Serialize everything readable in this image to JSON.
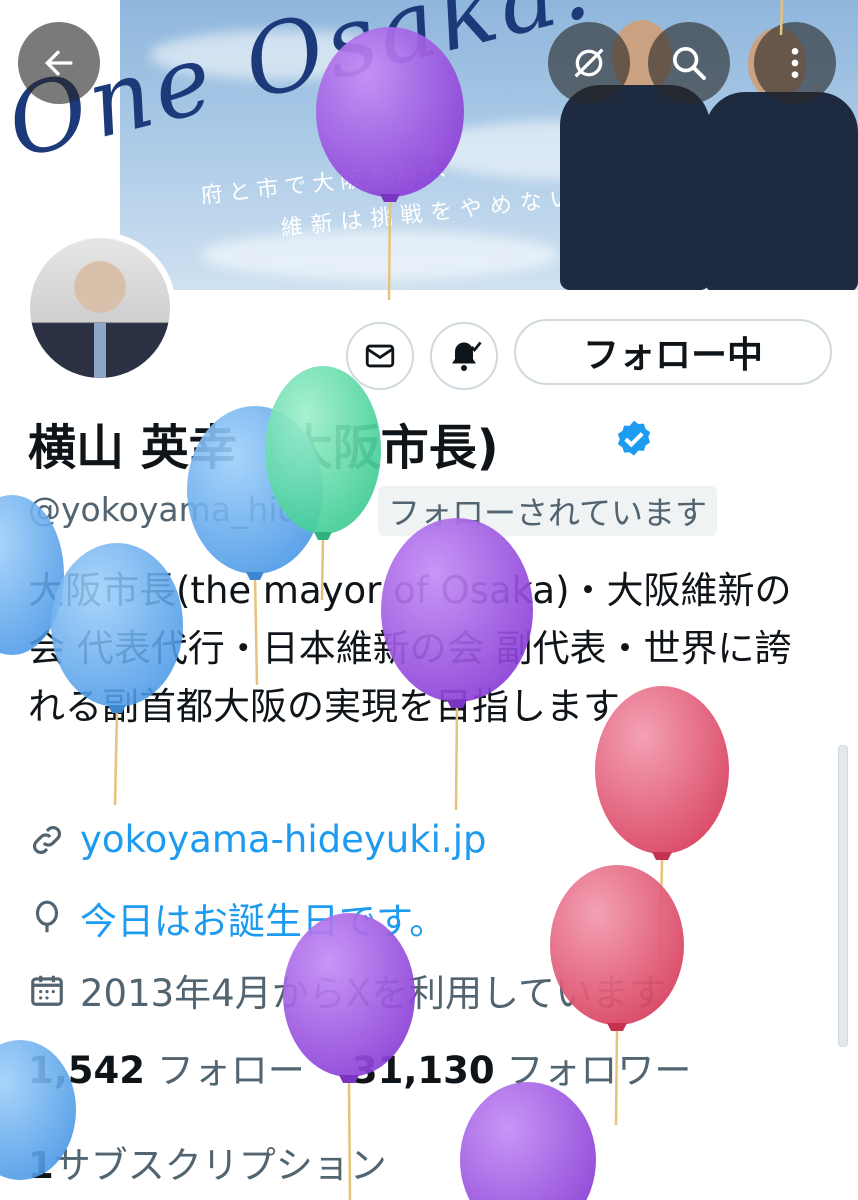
{
  "banner": {
    "slogan": "One Osaka!",
    "line1": "府と市で大阪を前へ",
    "line2": "維新は挑戦をやめない"
  },
  "profile": {
    "name": "横山 英幸（大阪市長)",
    "handle": "@yokoyama_hide",
    "follows_you": "フォローされています",
    "follow_button": "フォロー中",
    "bio": "大阪市長(the mayor of Osaka)・大阪維新の会 代表代行・日本維新の会 副代表・世界に誇れる副首都大阪の実現を目指します",
    "website": "yokoyama-hideyuki.jp",
    "birthday": "今日はお誕生日です。",
    "joined": "2013年4月からXを利用しています",
    "following_count": "1,542",
    "following_label": "フォロー",
    "followers_count": "31,130",
    "followers_label": "フォロワー",
    "subscriptions_count": "1",
    "subscriptions_label": "サブスクリプション"
  },
  "icons": {
    "back": "arrow-left-icon",
    "grok": "grok-icon",
    "search": "search-icon",
    "more": "more-vertical-icon",
    "message": "envelope-icon",
    "notify": "bell-icon",
    "verified": "verified-badge-icon",
    "link": "link-icon",
    "birthday": "balloon-icon",
    "calendar": "calendar-icon"
  },
  "colors": {
    "accent": "#1d9bf0",
    "text": "#0f1419",
    "muted": "#536471",
    "balloon_purple": "#9b4fe0",
    "balloon_blue": "#5aa8ee",
    "balloon_green": "#4fd6a0",
    "balloon_red": "#e0506e"
  }
}
